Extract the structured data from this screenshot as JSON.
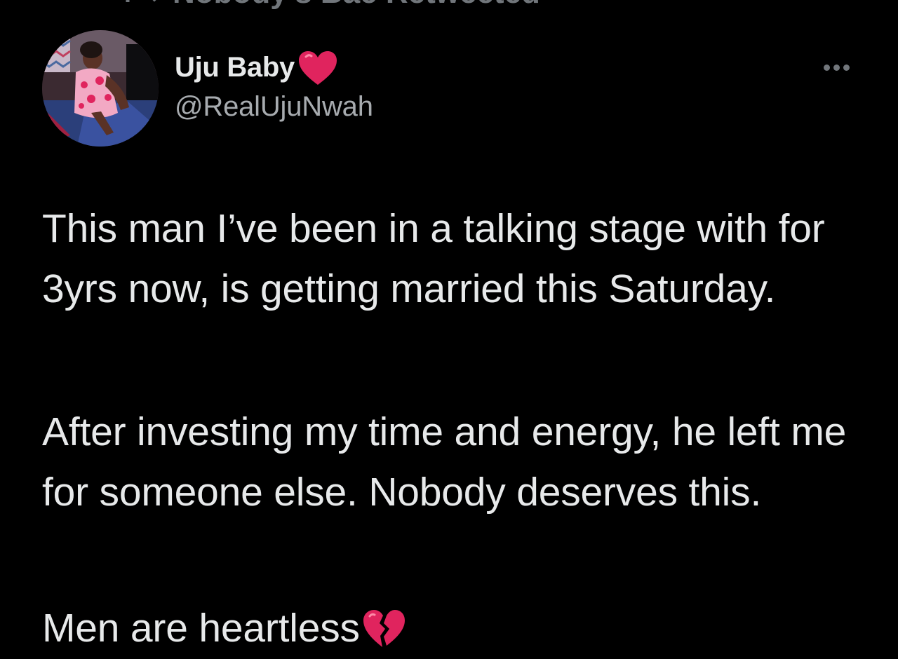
{
  "retweet_context": {
    "label": "Nobody's Bae Retweeted",
    "icon": "retweet-icon"
  },
  "author": {
    "display_name": "Uju Baby",
    "name_emoji": "red-heart-icon",
    "handle": "@RealUjuNwah"
  },
  "more_menu": {
    "icon": "more-horizontal-icon"
  },
  "tweet": {
    "paragraphs": [
      "This man I’ve been in a talking stage with for 3yrs now, is getting married this Saturday.",
      "After investing my time and energy, he left me for someone else. Nobody deserves this.",
      "Men are heartless"
    ],
    "closing_emoji": "broken-heart-icon"
  },
  "colors": {
    "background": "#000000",
    "primary_text": "#e7e9ea",
    "secondary_text": "#71767b",
    "heart_red": "#e0245e"
  }
}
